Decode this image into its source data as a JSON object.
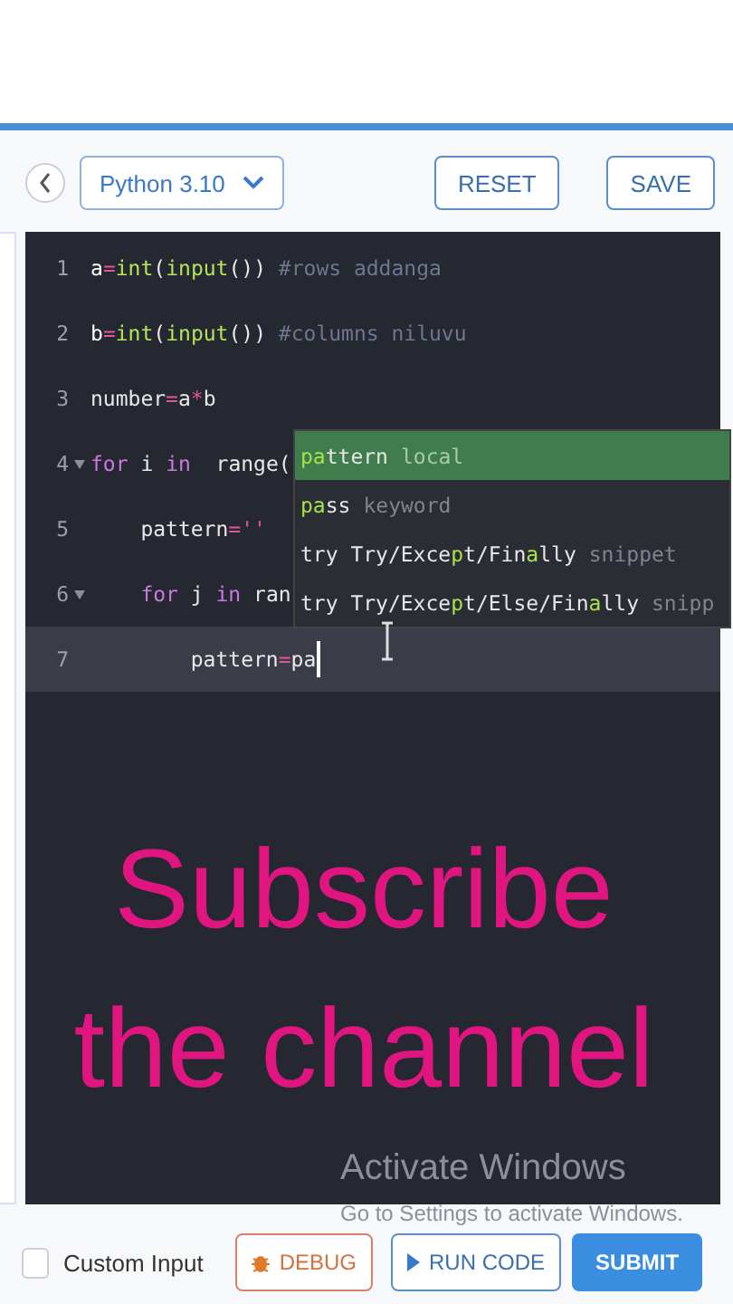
{
  "toolbar": {
    "language": "Python 3.10",
    "buttons": [
      "RESET",
      "SAVE"
    ]
  },
  "editor": {
    "lines": [
      {
        "number": "1",
        "fold": false,
        "active": false,
        "tokens": [
          {
            "text": "a",
            "kind": "var"
          },
          {
            "text": "=",
            "kind": "op"
          },
          {
            "text": "int",
            "kind": "fn"
          },
          {
            "text": "(",
            "kind": "plain"
          },
          {
            "text": "input",
            "kind": "fn"
          },
          {
            "text": "()) ",
            "kind": "plain"
          },
          {
            "text": "#rows addanga",
            "kind": "comment"
          }
        ]
      },
      {
        "number": "2",
        "fold": false,
        "active": false,
        "tokens": [
          {
            "text": "b",
            "kind": "var"
          },
          {
            "text": "=",
            "kind": "op"
          },
          {
            "text": "int",
            "kind": "fn"
          },
          {
            "text": "(",
            "kind": "plain"
          },
          {
            "text": "input",
            "kind": "fn"
          },
          {
            "text": "()) ",
            "kind": "plain"
          },
          {
            "text": "#columns niluvu",
            "kind": "comment"
          }
        ]
      },
      {
        "number": "3",
        "fold": false,
        "active": false,
        "tokens": [
          {
            "text": "number",
            "kind": "plain"
          },
          {
            "text": "=",
            "kind": "op"
          },
          {
            "text": "a",
            "kind": "plain"
          },
          {
            "text": "*",
            "kind": "op"
          },
          {
            "text": "b",
            "kind": "plain"
          }
        ]
      },
      {
        "number": "4",
        "fold": true,
        "active": false,
        "tokens": [
          {
            "text": "for",
            "kind": "keyword"
          },
          {
            "text": " i ",
            "kind": "plain"
          },
          {
            "text": "in",
            "kind": "keyword"
          },
          {
            "text": "  range(",
            "kind": "plain"
          }
        ]
      },
      {
        "number": "5",
        "fold": false,
        "active": false,
        "tokens": [
          {
            "text": "    pattern",
            "kind": "plain"
          },
          {
            "text": "=''",
            "kind": "op"
          }
        ]
      },
      {
        "number": "6",
        "fold": true,
        "active": false,
        "tokens": [
          {
            "text": "    for",
            "kind": "keyword"
          },
          {
            "text": " j ",
            "kind": "plain"
          },
          {
            "text": "in",
            "kind": "keyword"
          },
          {
            "text": " ran",
            "kind": "plain"
          }
        ]
      },
      {
        "number": "7",
        "fold": false,
        "active": true,
        "tokens": [
          {
            "text": "        pattern",
            "kind": "plain"
          },
          {
            "text": "=",
            "kind": "op"
          },
          {
            "text": "pa",
            "kind": "plain"
          }
        ]
      }
    ],
    "suggestions": [
      {
        "selected": true,
        "parts": [
          {
            "text": "pa",
            "match": true
          },
          {
            "text": "ttern",
            "match": false
          }
        ],
        "detail": "local"
      },
      {
        "selected": false,
        "parts": [
          {
            "text": "pa",
            "match": true
          },
          {
            "text": "ss",
            "match": false
          }
        ],
        "detail": "keyword"
      },
      {
        "selected": false,
        "parts": [
          {
            "text": "try Try/Exce",
            "match": false
          },
          {
            "text": "p",
            "match": true
          },
          {
            "text": "t/Fin",
            "match": false
          },
          {
            "text": "a",
            "match": true
          },
          {
            "text": "lly",
            "match": false
          }
        ],
        "detail": "snippet"
      },
      {
        "selected": false,
        "parts": [
          {
            "text": "try Try/Exce",
            "match": false
          },
          {
            "text": "p",
            "match": true
          },
          {
            "text": "t/Else/Fin",
            "match": false
          },
          {
            "text": "a",
            "match": true
          },
          {
            "text": "lly",
            "match": false
          }
        ],
        "detail": "snipp"
      }
    ]
  },
  "overlay": {
    "caption_lines": [
      "Subscribe",
      "the channel"
    ],
    "watermark": [
      "Activate Windows",
      "Go to Settings to activate Windows."
    ]
  },
  "footer": {
    "custom_input": {
      "label": "Custom Input",
      "checked": false
    },
    "debug": "DEBUG",
    "run": "RUN CODE",
    "submit": "SUBMIT"
  }
}
